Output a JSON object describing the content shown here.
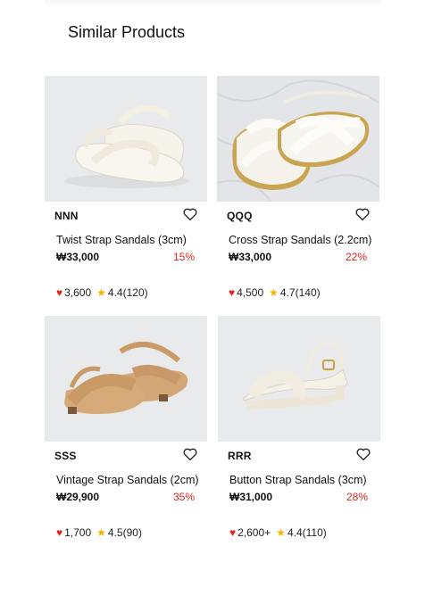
{
  "section_title": "Similar Products",
  "products": [
    {
      "brand": "NNN",
      "name": "Twist Strap Sandals (3cm)",
      "price": "₩33,000",
      "discount": "15%",
      "likes": "3,600",
      "rating": "4.4",
      "reviews": "(120)"
    },
    {
      "brand": "QQQ",
      "name": "Cross Strap Sandals (2.2cm)",
      "price": "₩33,000",
      "discount": "22%",
      "likes": "4,500",
      "rating": "4.7",
      "reviews": "(140)"
    },
    {
      "brand": "SSS",
      "name": "Vintage Strap Sandals (2cm)",
      "price": "₩29,900",
      "discount": "35%",
      "likes": "1,700",
      "rating": "4.5",
      "reviews": "(90)"
    },
    {
      "brand": "RRR",
      "name": "Button Strap Sandals (3cm)",
      "price": "₩31,000",
      "discount": "28%",
      "likes": "2,600+",
      "rating": "4.4",
      "reviews": "(110)"
    }
  ],
  "colors": {
    "discount": "#e0261b",
    "heart": "#e0261b",
    "star": "#f5b400",
    "image_bg": "#e9eaec"
  }
}
